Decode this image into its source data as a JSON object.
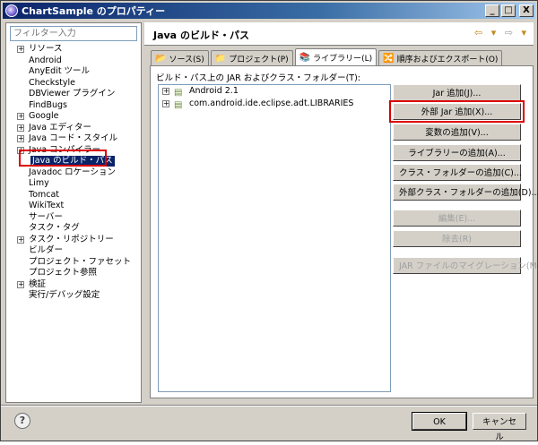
{
  "window": {
    "title": "ChartSample のプロパティー",
    "controls": [
      "_",
      "□",
      "X"
    ]
  },
  "filter": {
    "placeholder": "フィルター入力"
  },
  "tree": [
    {
      "label": "リソース",
      "expandable": true
    },
    {
      "label": "Android",
      "expandable": false
    },
    {
      "label": "AnyEdit ツール",
      "expandable": false
    },
    {
      "label": "Checkstyle",
      "expandable": false
    },
    {
      "label": "DBViewer プラグイン",
      "expandable": false
    },
    {
      "label": "FindBugs",
      "expandable": false
    },
    {
      "label": "Google",
      "expandable": true
    },
    {
      "label": "Java エディター",
      "expandable": true
    },
    {
      "label": "Java コード・スタイル",
      "expandable": true
    },
    {
      "label": "Java コンパイラー",
      "expandable": true
    },
    {
      "label": "Java のビルド・パス",
      "expandable": false,
      "selected": true
    },
    {
      "label": "Javadoc ロケーション",
      "expandable": false
    },
    {
      "label": "Limy",
      "expandable": false
    },
    {
      "label": "Tomcat",
      "expandable": false
    },
    {
      "label": "WikiText",
      "expandable": false
    },
    {
      "label": "サーバー",
      "expandable": false
    },
    {
      "label": "タスク・タグ",
      "expandable": false
    },
    {
      "label": "タスク・リポジトリー",
      "expandable": true
    },
    {
      "label": "ビルダー",
      "expandable": false
    },
    {
      "label": "プロジェクト・ファセット",
      "expandable": false
    },
    {
      "label": "プロジェクト参照",
      "expandable": false
    },
    {
      "label": "検証",
      "expandable": true
    },
    {
      "label": "実行/デバッグ設定",
      "expandable": false
    }
  ],
  "header": {
    "title": "Java のビルド・パス",
    "nav": {
      "back": "⇦",
      "dropdown": "▾",
      "forward": "⇨",
      "menu": "▾"
    }
  },
  "tabs": [
    {
      "label": "ソース(S)",
      "icon": "📂"
    },
    {
      "label": "プロジェクト(P)",
      "icon": "📁"
    },
    {
      "label": "ライブラリー(L)",
      "icon": "📚",
      "active": true
    },
    {
      "label": "順序およびエクスポート(O)",
      "icon": "🔀"
    }
  ],
  "libraries": {
    "list_label": "ビルド・パス上の JAR およびクラス・フォルダー(T):",
    "items": [
      {
        "label": "Android 2.1"
      },
      {
        "label": "com.android.ide.eclipse.adt.LIBRARIES"
      }
    ]
  },
  "buttons": [
    {
      "label": "Jar 追加(J)...",
      "enabled": true
    },
    {
      "label": "外部 Jar 追加(X)...",
      "enabled": true,
      "highlighted": true
    },
    {
      "label": "変数の追加(V)...",
      "enabled": true
    },
    {
      "label": "ライブラリーの追加(A)...",
      "enabled": true
    },
    {
      "label": "クラス・フォルダーの追加(C)...",
      "enabled": true
    },
    {
      "label": "外部クラス・フォルダーの追加(D)...",
      "enabled": true
    },
    {
      "label": "編集(E)...",
      "enabled": false
    },
    {
      "label": "除去(R)",
      "enabled": false
    },
    {
      "label": "JAR ファイルのマイグレーション(M)...",
      "enabled": false
    }
  ],
  "footer": {
    "help": "?",
    "ok": "OK",
    "cancel": "キャンセル"
  }
}
